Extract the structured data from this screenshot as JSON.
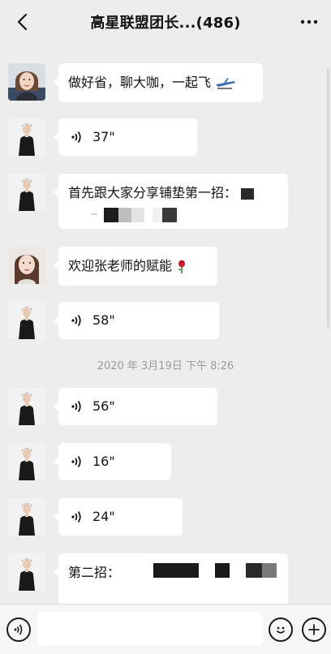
{
  "header": {
    "title": "高星联盟团长...(486)"
  },
  "messages": [
    {
      "sender": "woman-1",
      "type": "text",
      "text": "做好省，聊大咖，一起飞"
    },
    {
      "sender": "man",
      "type": "voice",
      "duration": "37\""
    },
    {
      "sender": "man",
      "type": "text",
      "text": "首先跟大家分享铺垫第一招："
    },
    {
      "sender": "woman-2",
      "type": "text",
      "text": "欢迎张老师的赋能"
    },
    {
      "sender": "man",
      "type": "voice",
      "duration": "58\""
    },
    {
      "type": "timestamp",
      "text": "2020 年 3月19日 下午 8:26"
    },
    {
      "sender": "man",
      "type": "voice",
      "duration": "56\""
    },
    {
      "sender": "man",
      "type": "voice",
      "duration": "16\""
    },
    {
      "sender": "man",
      "type": "voice",
      "duration": "24\""
    },
    {
      "sender": "man",
      "type": "text",
      "text": "第二招："
    }
  ],
  "input_bar": {
    "value": ""
  },
  "icons": {
    "back": "chevron-left-icon",
    "more": "more-dots-icon",
    "voice_toggle": "voice-mode-icon",
    "emoji": "emoji-icon",
    "add": "plus-icon"
  }
}
